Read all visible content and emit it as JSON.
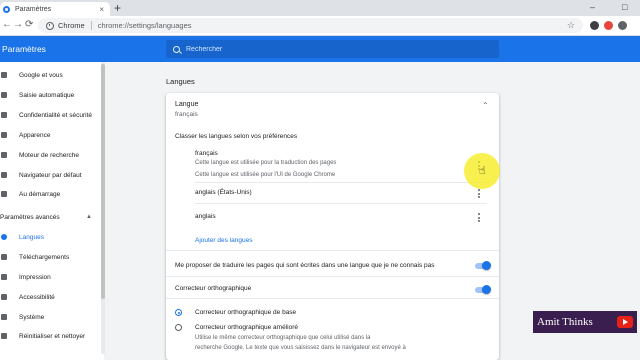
{
  "browser": {
    "tab_title": "Paramètres",
    "tab_close": "×",
    "new_tab": "+",
    "omnibox_label": "Chrome",
    "url": "chrome://settings/languages",
    "back": "←",
    "forward": "→",
    "reload": "⟳",
    "bookmark_star": "☆",
    "window_minimize": "–",
    "window_maximize": "□"
  },
  "header": {
    "title": "Paramètres",
    "search_placeholder": "Rechercher"
  },
  "sidebar": {
    "items": [
      {
        "label": "Google et vous",
        "icon": "person-icon"
      },
      {
        "label": "Saisie automatique",
        "icon": "clipboard-icon"
      },
      {
        "label": "Confidentialité et sécurité",
        "icon": "shield-icon"
      },
      {
        "label": "Apparence",
        "icon": "palette-icon"
      },
      {
        "label": "Moteur de recherche",
        "icon": "search-icon"
      },
      {
        "label": "Navigateur par défaut",
        "icon": "browser-icon"
      },
      {
        "label": "Au démarrage",
        "icon": "power-icon"
      }
    ],
    "advanced_label": "Paramètres avancés",
    "advanced_chevron": "▲",
    "advanced_items": [
      {
        "label": "Langues",
        "icon": "globe-icon",
        "active": true
      },
      {
        "label": "Téléchargements",
        "icon": "download-icon"
      },
      {
        "label": "Impression",
        "icon": "printer-icon"
      },
      {
        "label": "Accessibilité",
        "icon": "accessibility-icon"
      },
      {
        "label": "Système",
        "icon": "wrench-icon"
      },
      {
        "label": "Réinitialiser et nettoyer",
        "icon": "reset-icon"
      }
    ]
  },
  "main": {
    "section_title": "Langues",
    "card": {
      "title": "Langue",
      "subtitle": "français",
      "collapse_chevron": "⌃",
      "sort_label": "Classer les langues selon vos préférences",
      "languages": [
        {
          "name": "français",
          "notes": [
            "Cette langue est utilisée pour la traduction des pages",
            "Cette langue est utilisée pour l'UI de Google Chrome"
          ]
        },
        {
          "name": "anglais (États-Unis)",
          "notes": []
        },
        {
          "name": "anglais",
          "notes": []
        }
      ],
      "add_languages": "Ajouter des langues",
      "translate_toggle_label": "Me proposer de traduire les pages qui sont écrites dans une langue que je ne connais pas",
      "translate_toggle_on": true,
      "spellcheck_label": "Correcteur orthographique",
      "spellcheck_on": true,
      "spell_options": [
        {
          "label": "Correcteur orthographique de base",
          "checked": true,
          "desc": []
        },
        {
          "label": "Correcteur orthographique amélioré",
          "checked": false,
          "desc": [
            "Utilise le même correcteur orthographique que celui utilisé dans la",
            "recherche Google. Le texte que vous saisissez dans le navigateur est envoyé à"
          ]
        }
      ]
    }
  },
  "watermark": {
    "text": "Amit Thinks"
  },
  "colors": {
    "accent": "#1a73e8",
    "header_bg": "#1a73e8",
    "highlight": "#f6eb14",
    "watermark_bg": "#3a1e4f",
    "youtube_red": "#e62117"
  }
}
